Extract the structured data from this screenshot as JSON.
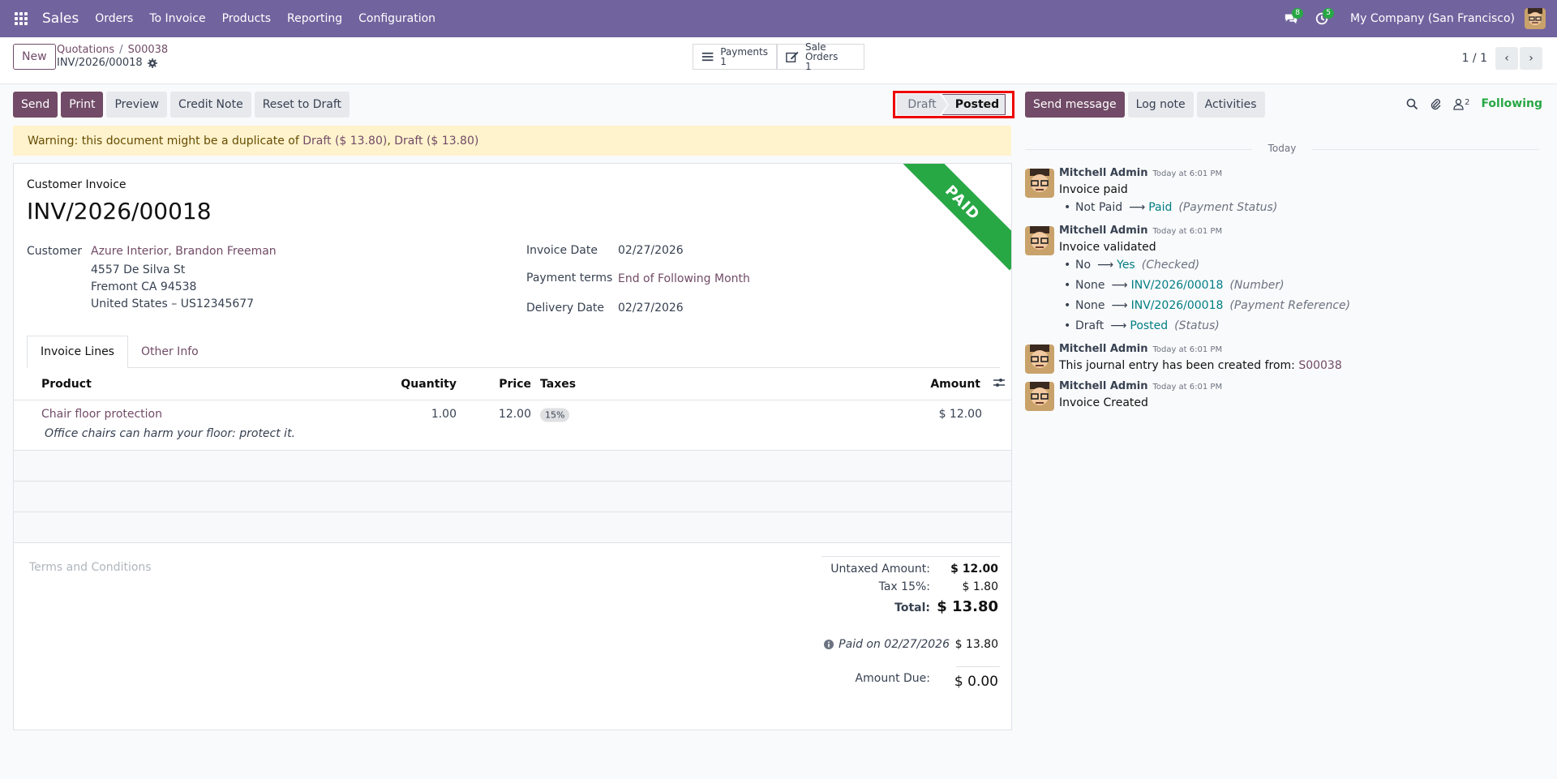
{
  "navbar": {
    "app_name": "Sales",
    "menu": [
      "Orders",
      "To Invoice",
      "Products",
      "Reporting",
      "Configuration"
    ],
    "messages_count": "8",
    "activities_count": "5",
    "company": "My Company (San Francisco)"
  },
  "control_panel": {
    "new_label": "New",
    "breadcrumb": [
      "Quotations",
      "S00038"
    ],
    "record_name": "INV/2026/00018",
    "smart_buttons": [
      {
        "label": "Payments",
        "value": "1",
        "icon": "list-icon"
      },
      {
        "label": "Sale Orders",
        "value": "1",
        "icon": "edit-icon"
      }
    ],
    "pager": "1 / 1"
  },
  "actions": {
    "send": "Send",
    "print": "Print",
    "preview": "Preview",
    "credit_note": "Credit Note",
    "reset_to_draft": "Reset to Draft"
  },
  "statusbar": {
    "draft": "Draft",
    "posted": "Posted",
    "current": "Posted"
  },
  "warning": {
    "text": "Warning: this document might be a duplicate of",
    "links": [
      "Draft ($ 13.80)",
      "Draft ($ 13.80)"
    ]
  },
  "invoice": {
    "ribbon": "PAID",
    "type": "Customer Invoice",
    "name": "INV/2026/00018",
    "customer_label": "Customer",
    "customer_name": "Azure Interior, Brandon Freeman",
    "address": [
      "4557 De Silva St",
      "Fremont CA 94538",
      "United States – US12345677"
    ],
    "invoice_date_label": "Invoice Date",
    "invoice_date": "02/27/2026",
    "payment_terms_label": "Payment terms",
    "payment_terms": "End of Following Month",
    "delivery_date_label": "Delivery Date",
    "delivery_date": "02/27/2026",
    "tabs": [
      "Invoice Lines",
      "Other Info"
    ],
    "columns": [
      "Product",
      "Quantity",
      "Price",
      "Taxes",
      "Amount"
    ],
    "lines": [
      {
        "product": "Chair floor protection",
        "description": "Office chairs can harm your floor: protect it.",
        "quantity": "1.00",
        "price": "12.00",
        "tax": "15%",
        "amount": "$ 12.00"
      }
    ],
    "terms_placeholder": "Terms and Conditions",
    "untaxed_label": "Untaxed Amount:",
    "untaxed": "$ 12.00",
    "tax_label": "Tax 15%:",
    "tax": "$ 1.80",
    "total_label": "Total:",
    "total": "$ 13.80",
    "paid_on": "Paid on 02/27/2026",
    "paid_amount": "$ 13.80",
    "amount_due_label": "Amount Due:",
    "amount_due": "$ 0.00"
  },
  "chatter": {
    "send_message": "Send message",
    "log_note": "Log note",
    "activities": "Activities",
    "followers_count": "2",
    "following": "Following",
    "today": "Today",
    "messages": [
      {
        "author": "Mitchell Admin",
        "date": "Today at 6:01 PM",
        "body": "Invoice paid",
        "tracking": [
          {
            "old": "Not Paid",
            "new": "Paid",
            "field": "(Payment Status)"
          }
        ]
      },
      {
        "author": "Mitchell Admin",
        "date": "Today at 6:01 PM",
        "body": "Invoice validated",
        "tracking": [
          {
            "old": "No",
            "new": "Yes",
            "field": "(Checked)"
          },
          {
            "old": "None",
            "new": "INV/2026/00018",
            "field": "(Number)"
          },
          {
            "old": "None",
            "new": "INV/2026/00018",
            "field": "(Payment Reference)"
          },
          {
            "old": "Draft",
            "new": "Posted",
            "field": "(Status)"
          }
        ]
      },
      {
        "author": "Mitchell Admin",
        "date": "Today at 6:01 PM",
        "body": "This journal entry has been created from:",
        "link": "S00038"
      },
      {
        "author": "Mitchell Admin",
        "date": "Today at 6:01 PM",
        "body": "Invoice Created"
      }
    ]
  },
  "colors": {
    "brand": "#71639e",
    "primary": "#714b67",
    "paid": "#28a745",
    "warning_bg": "#fff3cd",
    "link_teal": "#017e84"
  }
}
